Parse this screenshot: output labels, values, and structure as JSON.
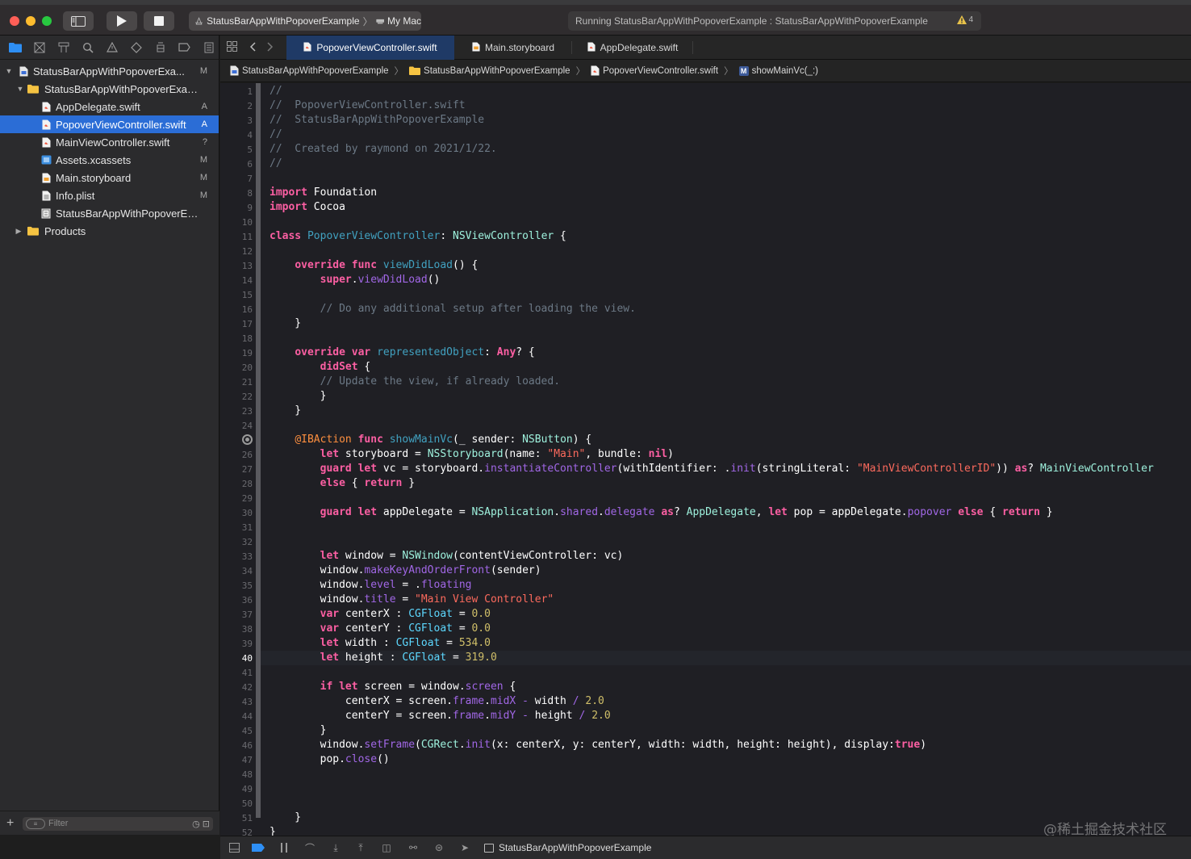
{
  "window": {
    "scheme": "StatusBarAppWithPopoverExample",
    "destination": "My Mac",
    "activity": "Running StatusBarAppWithPopoverExample : StatusBarAppWithPopoverExample",
    "warning_count": "4",
    "colors": {
      "accent": "#2b6dd6",
      "run": "#ffffff"
    }
  },
  "navigator": {
    "icons": [
      "folder-icon",
      "source-control-icon",
      "hierarchy-icon",
      "find-icon",
      "issue-icon",
      "test-icon",
      "debug-icon",
      "breakpoint-icon",
      "report-icon"
    ],
    "tree": [
      {
        "name": "StatusBarAppWithPopoverExa...",
        "badge": "M",
        "level": 0,
        "kind": "project",
        "disclosure": "▼"
      },
      {
        "name": "StatusBarAppWithPopoverExam...",
        "badge": "",
        "level": 1,
        "kind": "folder",
        "disclosure": "▼"
      },
      {
        "name": "AppDelegate.swift",
        "badge": "A",
        "level": 2,
        "kind": "swift",
        "disclosure": ""
      },
      {
        "name": "PopoverViewController.swift",
        "badge": "A",
        "level": 2,
        "kind": "swift",
        "disclosure": "",
        "selected": true
      },
      {
        "name": "MainViewController.swift",
        "badge": "?",
        "level": 2,
        "kind": "swift",
        "disclosure": ""
      },
      {
        "name": "Assets.xcassets",
        "badge": "M",
        "level": 2,
        "kind": "assets",
        "disclosure": ""
      },
      {
        "name": "Main.storyboard",
        "badge": "M",
        "level": 2,
        "kind": "storyboard",
        "disclosure": ""
      },
      {
        "name": "Info.plist",
        "badge": "M",
        "level": 2,
        "kind": "plist",
        "disclosure": ""
      },
      {
        "name": "StatusBarAppWithPopoverEx...",
        "badge": "",
        "level": 2,
        "kind": "entitlements",
        "disclosure": ""
      },
      {
        "name": "Products",
        "badge": "",
        "level": 1,
        "kind": "folder",
        "disclosure": "▶",
        "outdent": true
      }
    ],
    "filter_placeholder": "Filter"
  },
  "tabs": [
    {
      "label": "PopoverViewController.swift",
      "active": true
    },
    {
      "label": "Main.storyboard",
      "active": false
    },
    {
      "label": "AppDelegate.swift",
      "active": false
    }
  ],
  "jumpbar": {
    "project": "StatusBarAppWithPopoverExample",
    "group": "StatusBarAppWithPopoverExample",
    "file": "PopoverViewController.swift",
    "symbol_badge": "M",
    "symbol": "showMainVc(_:)"
  },
  "editor": {
    "current_line": 40,
    "breakpoint_line": 25,
    "lines": [
      [
        [
          "com",
          "//"
        ]
      ],
      [
        [
          "com",
          "//  PopoverViewController.swift"
        ]
      ],
      [
        [
          "com",
          "//  StatusBarAppWithPopoverExample"
        ]
      ],
      [
        [
          "com",
          "//"
        ]
      ],
      [
        [
          "com",
          "//  Created by raymond on 2021/1/22."
        ]
      ],
      [
        [
          "com",
          "//"
        ]
      ],
      [],
      [
        [
          "kw",
          "import"
        ],
        [
          "plain",
          " Foundation"
        ]
      ],
      [
        [
          "kw",
          "import"
        ],
        [
          "plain",
          " Cocoa"
        ]
      ],
      [],
      [
        [
          "kw",
          "class"
        ],
        [
          "plain",
          " "
        ],
        [
          "decl",
          "PopoverViewController"
        ],
        [
          "plain",
          ": "
        ],
        [
          "cls",
          "NSViewController"
        ],
        [
          "plain",
          " {"
        ]
      ],
      [],
      [
        [
          "plain",
          "    "
        ],
        [
          "kw",
          "override"
        ],
        [
          "plain",
          " "
        ],
        [
          "kw",
          "func"
        ],
        [
          "plain",
          " "
        ],
        [
          "decl",
          "viewDidLoad"
        ],
        [
          "plain",
          "() {"
        ]
      ],
      [
        [
          "plain",
          "        "
        ],
        [
          "kw",
          "super"
        ],
        [
          "plain",
          "."
        ],
        [
          "other",
          "viewDidLoad"
        ],
        [
          "plain",
          "()"
        ]
      ],
      [],
      [
        [
          "plain",
          "        "
        ],
        [
          "com",
          "// Do any additional setup after loading the view."
        ]
      ],
      [
        [
          "plain",
          "    }"
        ]
      ],
      [],
      [
        [
          "plain",
          "    "
        ],
        [
          "kw",
          "override"
        ],
        [
          "plain",
          " "
        ],
        [
          "kw",
          "var"
        ],
        [
          "plain",
          " "
        ],
        [
          "decl",
          "representedObject"
        ],
        [
          "plain",
          ": "
        ],
        [
          "kw",
          "Any"
        ],
        [
          "plain",
          "? {"
        ]
      ],
      [
        [
          "plain",
          "        "
        ],
        [
          "kw",
          "didSet"
        ],
        [
          "plain",
          " {"
        ]
      ],
      [
        [
          "plain",
          "        "
        ],
        [
          "com",
          "// Update the view, if already loaded."
        ]
      ],
      [
        [
          "plain",
          "        }"
        ]
      ],
      [
        [
          "plain",
          "    }"
        ]
      ],
      [],
      [
        [
          "plain",
          "    "
        ],
        [
          "attr",
          "@IBAction"
        ],
        [
          "plain",
          " "
        ],
        [
          "kw",
          "func"
        ],
        [
          "plain",
          " "
        ],
        [
          "decl",
          "showMainVc"
        ],
        [
          "plain",
          "(_ sender: "
        ],
        [
          "cls",
          "NSButton"
        ],
        [
          "plain",
          ") {"
        ]
      ],
      [
        [
          "plain",
          "        "
        ],
        [
          "kw",
          "let"
        ],
        [
          "plain",
          " storyboard = "
        ],
        [
          "cls",
          "NSStoryboard"
        ],
        [
          "plain",
          "(name: "
        ],
        [
          "str",
          "\"Main\""
        ],
        [
          "plain",
          ", bundle: "
        ],
        [
          "kw",
          "nil"
        ],
        [
          "plain",
          ")"
        ]
      ],
      [
        [
          "plain",
          "        "
        ],
        [
          "kw",
          "guard"
        ],
        [
          "plain",
          " "
        ],
        [
          "kw",
          "let"
        ],
        [
          "plain",
          " vc = storyboard."
        ],
        [
          "other",
          "instantiateController"
        ],
        [
          "plain",
          "(withIdentifier: ."
        ],
        [
          "other",
          "init"
        ],
        [
          "plain",
          "(stringLiteral: "
        ],
        [
          "str",
          "\"MainViewControllerID\""
        ],
        [
          "plain",
          "))"
        ],
        [
          "plain",
          " "
        ],
        [
          "kw",
          "as"
        ],
        [
          "plain",
          "? "
        ],
        [
          "cls",
          "MainViewController"
        ]
      ],
      [
        [
          "plain",
          "        "
        ],
        [
          "kw",
          "else"
        ],
        [
          "plain",
          " { "
        ],
        [
          "kw",
          "return"
        ],
        [
          "plain",
          " }"
        ]
      ],
      [],
      [
        [
          "plain",
          "        "
        ],
        [
          "kw",
          "guard"
        ],
        [
          "plain",
          " "
        ],
        [
          "kw",
          "let"
        ],
        [
          "plain",
          " appDelegate = "
        ],
        [
          "cls",
          "NSApplication"
        ],
        [
          "plain",
          "."
        ],
        [
          "other",
          "shared"
        ],
        [
          "plain",
          "."
        ],
        [
          "other",
          "delegate"
        ],
        [
          "plain",
          " "
        ],
        [
          "kw",
          "as"
        ],
        [
          "plain",
          "? "
        ],
        [
          "cls",
          "AppDelegate"
        ],
        [
          "plain",
          ", "
        ],
        [
          "kw",
          "let"
        ],
        [
          "plain",
          " pop = appDelegate."
        ],
        [
          "other",
          "popover"
        ],
        [
          "plain",
          " "
        ],
        [
          "kw",
          "else"
        ],
        [
          "plain",
          " { "
        ],
        [
          "kw",
          "return"
        ],
        [
          "plain",
          " }"
        ]
      ],
      [],
      [],
      [
        [
          "plain",
          "        "
        ],
        [
          "kw",
          "let"
        ],
        [
          "plain",
          " window = "
        ],
        [
          "cls",
          "NSWindow"
        ],
        [
          "plain",
          "(contentViewController: vc)"
        ]
      ],
      [
        [
          "plain",
          "        window."
        ],
        [
          "other",
          "makeKeyAndOrderFront"
        ],
        [
          "plain",
          "(sender)"
        ]
      ],
      [
        [
          "plain",
          "        window."
        ],
        [
          "other",
          "level"
        ],
        [
          "plain",
          " = ."
        ],
        [
          "other",
          "floating"
        ]
      ],
      [
        [
          "plain",
          "        window."
        ],
        [
          "other",
          "title"
        ],
        [
          "plain",
          " = "
        ],
        [
          "str",
          "\"Main View Controller\""
        ]
      ],
      [
        [
          "plain",
          "        "
        ],
        [
          "kw",
          "var"
        ],
        [
          "plain",
          " centerX : "
        ],
        [
          "type",
          "CGFloat"
        ],
        [
          "plain",
          " = "
        ],
        [
          "num",
          "0.0"
        ]
      ],
      [
        [
          "plain",
          "        "
        ],
        [
          "kw",
          "var"
        ],
        [
          "plain",
          " centerY : "
        ],
        [
          "type",
          "CGFloat"
        ],
        [
          "plain",
          " = "
        ],
        [
          "num",
          "0.0"
        ]
      ],
      [
        [
          "plain",
          "        "
        ],
        [
          "kw",
          "let"
        ],
        [
          "plain",
          " width : "
        ],
        [
          "type",
          "CGFloat"
        ],
        [
          "plain",
          " = "
        ],
        [
          "num",
          "534.0"
        ]
      ],
      [
        [
          "plain",
          "        "
        ],
        [
          "kw",
          "let"
        ],
        [
          "plain",
          " height : "
        ],
        [
          "type",
          "CGFloat"
        ],
        [
          "plain",
          " = "
        ],
        [
          "num",
          "319.0"
        ]
      ],
      [],
      [
        [
          "plain",
          "        "
        ],
        [
          "kw",
          "if"
        ],
        [
          "plain",
          " "
        ],
        [
          "kw",
          "let"
        ],
        [
          "plain",
          " screen = window."
        ],
        [
          "other",
          "screen"
        ],
        [
          "plain",
          " {"
        ]
      ],
      [
        [
          "plain",
          "            centerX = screen."
        ],
        [
          "other",
          "frame"
        ],
        [
          "plain",
          "."
        ],
        [
          "other",
          "midX"
        ],
        [
          "plain",
          " "
        ],
        [
          "other",
          "-"
        ],
        [
          "plain",
          " width "
        ],
        [
          "other",
          "/"
        ],
        [
          "plain",
          " "
        ],
        [
          "num",
          "2.0"
        ]
      ],
      [
        [
          "plain",
          "            centerY = screen."
        ],
        [
          "other",
          "frame"
        ],
        [
          "plain",
          "."
        ],
        [
          "other",
          "midY"
        ],
        [
          "plain",
          " "
        ],
        [
          "other",
          "-"
        ],
        [
          "plain",
          " height "
        ],
        [
          "other",
          "/"
        ],
        [
          "plain",
          " "
        ],
        [
          "num",
          "2.0"
        ]
      ],
      [
        [
          "plain",
          "        }"
        ]
      ],
      [
        [
          "plain",
          "        window."
        ],
        [
          "other",
          "setFrame"
        ],
        [
          "plain",
          "("
        ],
        [
          "cls",
          "CGRect"
        ],
        [
          "plain",
          "."
        ],
        [
          "other",
          "init"
        ],
        [
          "plain",
          "(x: centerX, y: centerY, width: width, height: height), display:"
        ],
        [
          "kw",
          "true"
        ],
        [
          "plain",
          ")"
        ]
      ],
      [
        [
          "plain",
          "        pop."
        ],
        [
          "other",
          "close"
        ],
        [
          "plain",
          "()"
        ]
      ],
      [],
      [],
      [],
      [
        [
          "plain",
          "    }"
        ]
      ],
      [
        [
          "plain",
          "}"
        ]
      ]
    ]
  },
  "debugbar": {
    "target": "StatusBarAppWithPopoverExample"
  },
  "watermark": "@稀土掘金技术社区"
}
